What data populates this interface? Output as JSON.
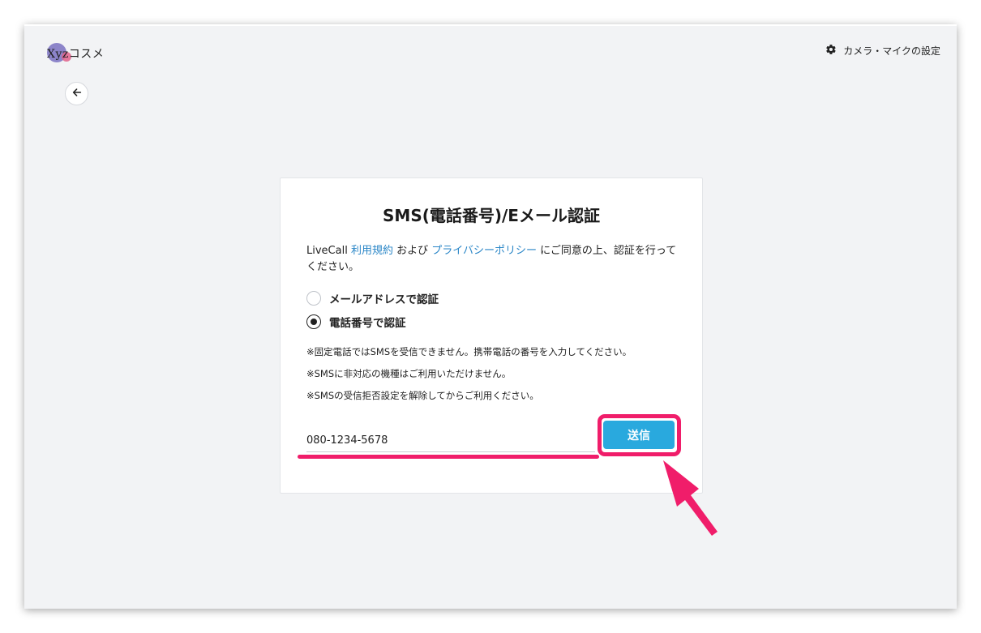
{
  "header": {
    "logo_text": "Xyzコスメ",
    "settings_label": "カメラ・マイクの設定"
  },
  "card": {
    "title": "SMS(電話番号)/Eメール認証",
    "terms": {
      "prefix": "LiveCall ",
      "terms_link": "利用規約",
      "and": " および ",
      "privacy_link": "プライバシーポリシー",
      "suffix": " にご同意の上、認証を行ってください。"
    },
    "options": [
      {
        "label": "メールアドレスで認証",
        "checked": false
      },
      {
        "label": "電話番号で認証",
        "checked": true
      }
    ],
    "notes": [
      "※固定電話ではSMSを受信できません。携帯電話の番号を入力してください。",
      "※SMSに非対応の機種はご利用いただけません。",
      "※SMSの受信拒否設定を解除してからご利用ください。"
    ],
    "phone_value": "080-1234-5678",
    "submit_label": "送信"
  },
  "colors": {
    "accent": "#29a9de",
    "link": "#2a86c7",
    "annotation": "#f01d6a",
    "background": "#f2f3f5"
  },
  "icons": {
    "settings": "gear-icon",
    "back": "arrow-left-icon"
  }
}
